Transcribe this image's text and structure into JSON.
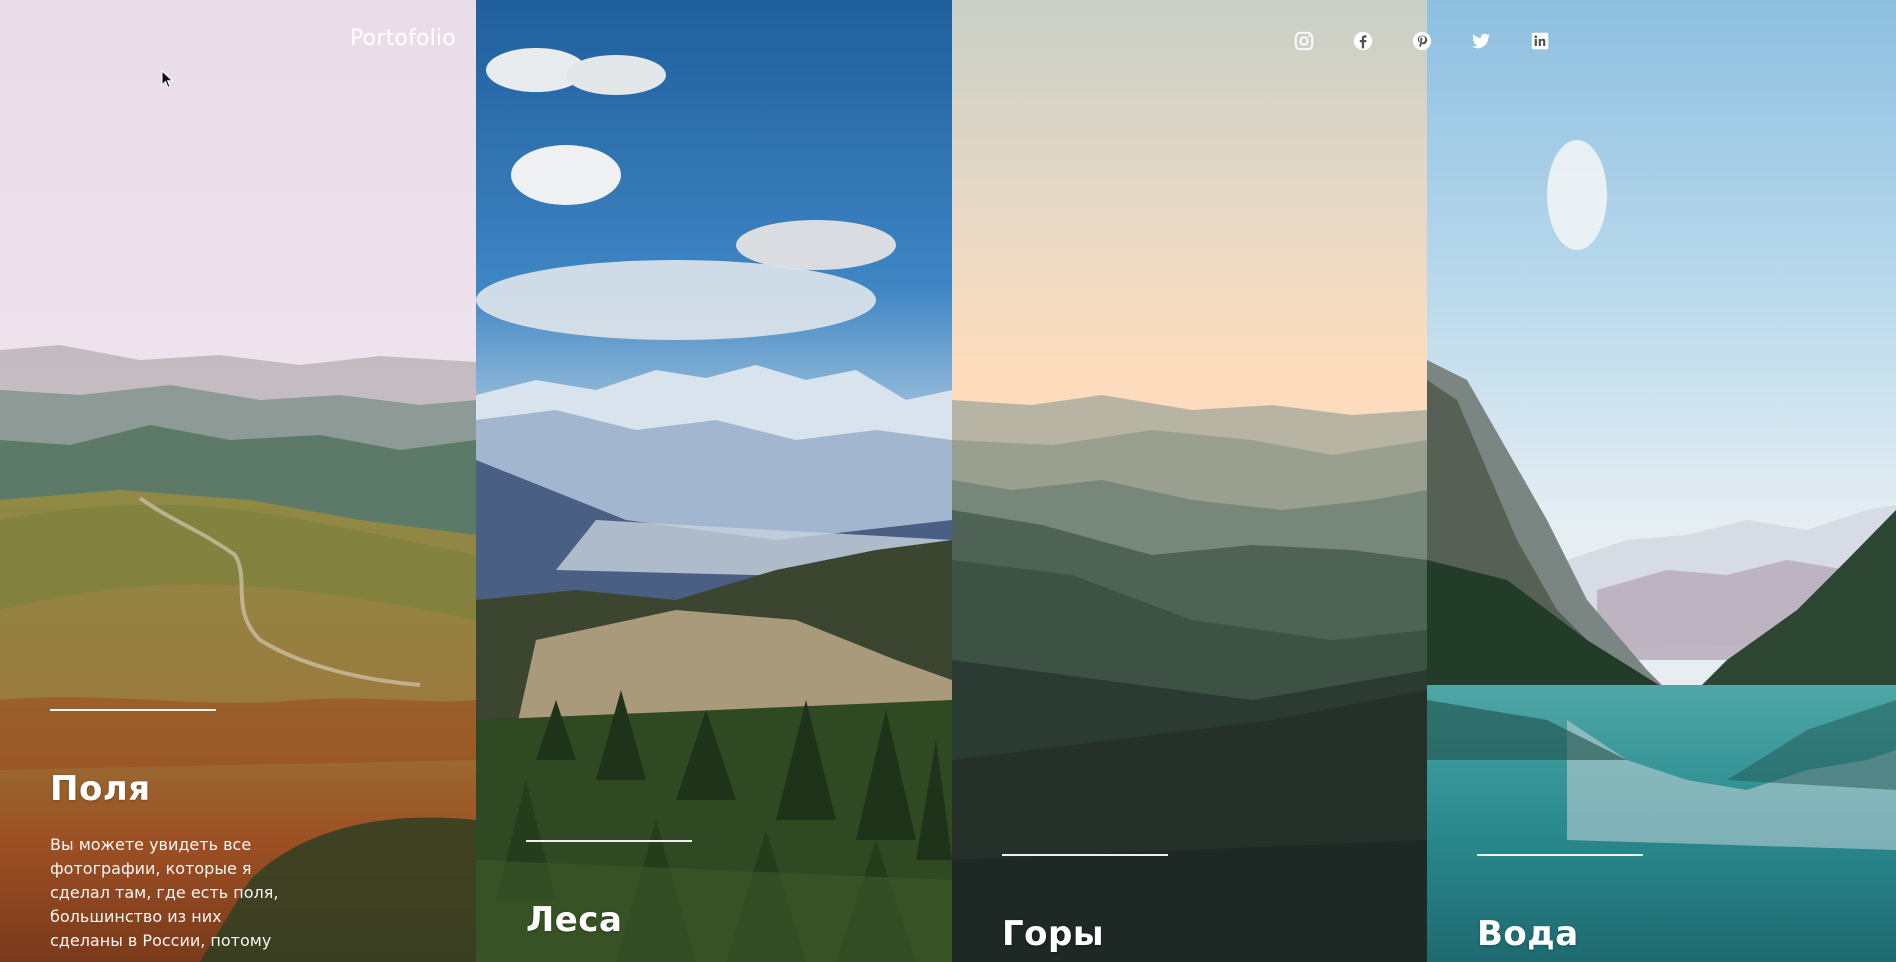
{
  "header": {
    "brand": "Portofolio",
    "social": [
      {
        "name": "instagram",
        "icon": "instagram-icon"
      },
      {
        "name": "facebook",
        "icon": "facebook-icon"
      },
      {
        "name": "pinterest",
        "icon": "pinterest-icon"
      },
      {
        "name": "twitter",
        "icon": "twitter-icon"
      },
      {
        "name": "linkedin",
        "icon": "linkedin-icon"
      }
    ]
  },
  "panels": [
    {
      "title": "Поля",
      "description": "Вы можете увидеть все фотографии, которые я сделал там, где есть поля, большинство из них сделаны в России, потому"
    },
    {
      "title": "Леса"
    },
    {
      "title": "Горы"
    },
    {
      "title": "Вода"
    }
  ],
  "colors": {
    "text": "#ffffff",
    "fields_sky": "#efe2ec",
    "forest_sky": "#2f76b8",
    "mountains_sky": "#fcdcbc",
    "water_lake": "#2a8b8f"
  }
}
